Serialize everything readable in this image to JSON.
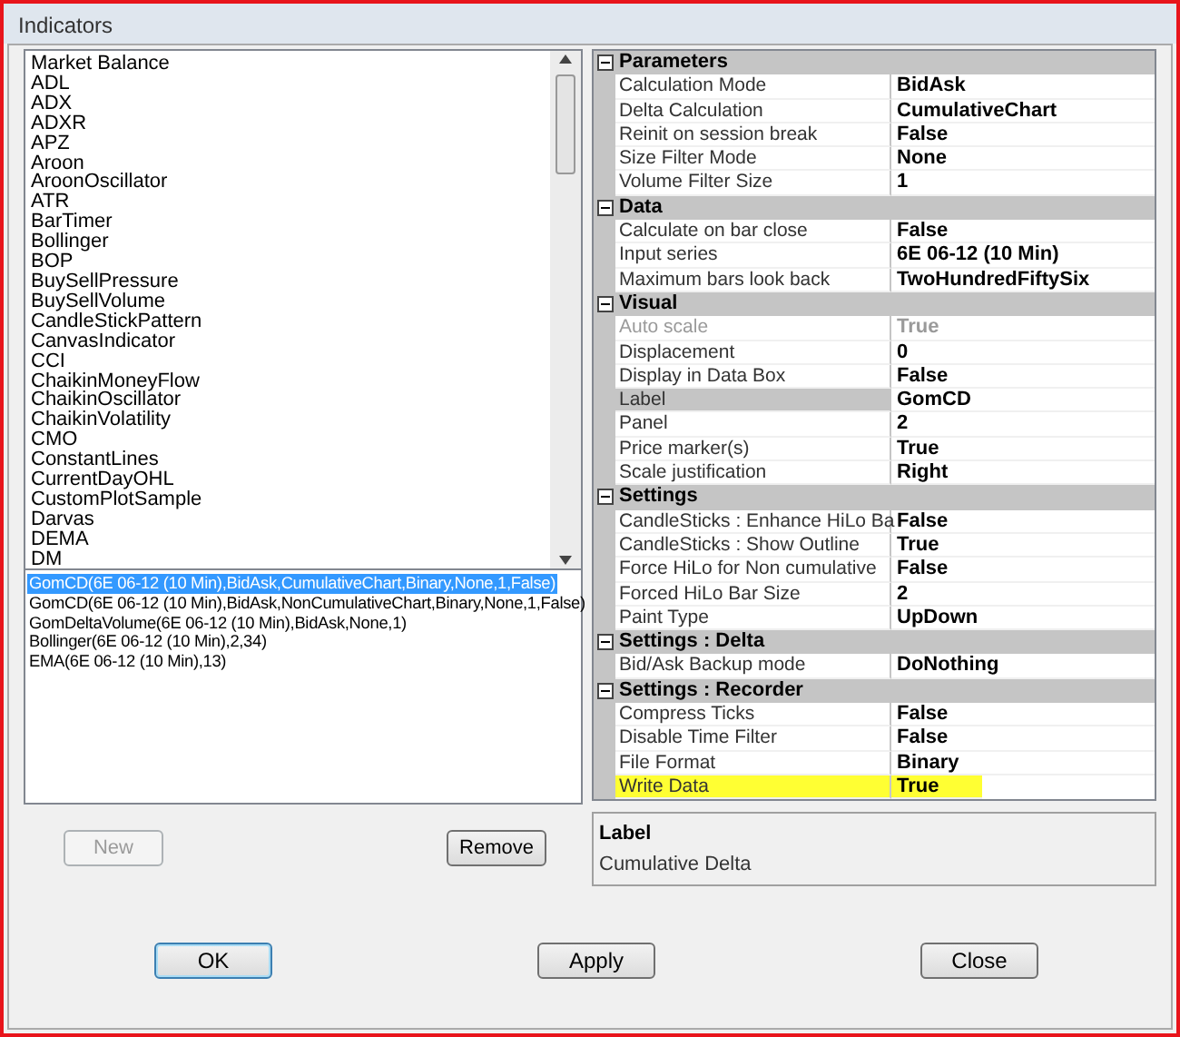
{
  "window": {
    "title": "Indicators"
  },
  "indicator_list": {
    "items": [
      "Market Balance",
      "ADL",
      "ADX",
      "ADXR",
      "APZ",
      "Aroon",
      "AroonOscillator",
      "ATR",
      "BarTimer",
      "Bollinger",
      "BOP",
      "BuySellPressure",
      "BuySellVolume",
      "CandleStickPattern",
      "CanvasIndicator",
      "CCI",
      "ChaikinMoneyFlow",
      "ChaikinOscillator",
      "ChaikinVolatility",
      "CMO",
      "ConstantLines",
      "CurrentDayOHL",
      "CustomPlotSample",
      "Darvas",
      "DEMA",
      "DM"
    ]
  },
  "applied_list": {
    "items": [
      {
        "label": "GomCD(6E 06-12 (10 Min),BidAsk,CumulativeChart,Binary,None,1,False)",
        "selected": true
      },
      {
        "label": "GomCD(6E 06-12 (10 Min),BidAsk,NonCumulativeChart,Binary,None,1,False)",
        "selected": false
      },
      {
        "label": "GomDeltaVolume(6E 06-12 (10 Min),BidAsk,None,1)",
        "selected": false
      },
      {
        "label": "Bollinger(6E 06-12 (10 Min),2,34)",
        "selected": false
      },
      {
        "label": "EMA(6E 06-12 (10 Min),13)",
        "selected": false
      }
    ]
  },
  "list_buttons": [
    {
      "label": "New",
      "disabled": true
    },
    {
      "label": "Remove",
      "disabled": false
    }
  ],
  "properties": {
    "categories": [
      {
        "name": "Parameters",
        "expanded": true,
        "rows": [
          {
            "label": "Calculation Mode",
            "value": "BidAsk",
            "disabled": false,
            "selected": false,
            "highlighted": false
          },
          {
            "label": "Delta Calculation",
            "value": "CumulativeChart",
            "disabled": false,
            "selected": false,
            "highlighted": false
          },
          {
            "label": "Reinit on session break",
            "value": "False",
            "disabled": false,
            "selected": false,
            "highlighted": false
          },
          {
            "label": "Size Filter Mode",
            "value": "None",
            "disabled": false,
            "selected": false,
            "highlighted": false
          },
          {
            "label": "Volume Filter Size",
            "value": "1",
            "disabled": false,
            "selected": false,
            "highlighted": false
          }
        ]
      },
      {
        "name": "Data",
        "expanded": true,
        "rows": [
          {
            "label": "Calculate on bar close",
            "value": "False",
            "disabled": false,
            "selected": false,
            "highlighted": false
          },
          {
            "label": "Input series",
            "value": "6E 06-12 (10 Min)",
            "disabled": false,
            "selected": false,
            "highlighted": false
          },
          {
            "label": "Maximum bars look back",
            "value": "TwoHundredFiftySix",
            "disabled": false,
            "selected": false,
            "highlighted": false
          }
        ]
      },
      {
        "name": "Visual",
        "expanded": true,
        "rows": [
          {
            "label": "Auto scale",
            "value": "True",
            "disabled": true,
            "selected": false,
            "highlighted": false
          },
          {
            "label": "Displacement",
            "value": "0",
            "disabled": false,
            "selected": false,
            "highlighted": false
          },
          {
            "label": "Display in Data Box",
            "value": "False",
            "disabled": false,
            "selected": false,
            "highlighted": false
          },
          {
            "label": "Label",
            "value": "GomCD",
            "disabled": false,
            "selected": true,
            "highlighted": false
          },
          {
            "label": "Panel",
            "value": "2",
            "disabled": false,
            "selected": false,
            "highlighted": false
          },
          {
            "label": "Price marker(s)",
            "value": "True",
            "disabled": false,
            "selected": false,
            "highlighted": false
          },
          {
            "label": "Scale justification",
            "value": "Right",
            "disabled": false,
            "selected": false,
            "highlighted": false
          }
        ]
      },
      {
        "name": "Settings",
        "expanded": true,
        "rows": [
          {
            "label": "CandleSticks : Enhance HiLo Ba",
            "value": "False",
            "disabled": false,
            "selected": false,
            "highlighted": false
          },
          {
            "label": "CandleSticks : Show Outline",
            "value": "True",
            "disabled": false,
            "selected": false,
            "highlighted": false
          },
          {
            "label": "Force HiLo for Non cumulative",
            "value": "False",
            "disabled": false,
            "selected": false,
            "highlighted": false
          },
          {
            "label": "Forced HiLo Bar Size",
            "value": "2",
            "disabled": false,
            "selected": false,
            "highlighted": false
          },
          {
            "label": "Paint Type",
            "value": "UpDown",
            "disabled": false,
            "selected": false,
            "highlighted": false
          }
        ]
      },
      {
        "name": "Settings : Delta",
        "expanded": true,
        "rows": [
          {
            "label": "Bid/Ask Backup mode",
            "value": "DoNothing",
            "disabled": false,
            "selected": false,
            "highlighted": false
          }
        ]
      },
      {
        "name": "Settings : Recorder",
        "expanded": true,
        "rows": [
          {
            "label": "Compress Ticks",
            "value": "False",
            "disabled": false,
            "selected": false,
            "highlighted": false
          },
          {
            "label": "Disable Time Filter",
            "value": "False",
            "disabled": false,
            "selected": false,
            "highlighted": false
          },
          {
            "label": "File Format",
            "value": "Binary",
            "disabled": false,
            "selected": false,
            "highlighted": false
          },
          {
            "label": "Write Data",
            "value": "True",
            "disabled": false,
            "selected": false,
            "highlighted": true
          }
        ]
      }
    ]
  },
  "description": {
    "title": "Label",
    "text": "Cumulative Delta"
  },
  "dialog_buttons": [
    {
      "label": "OK",
      "default": true
    },
    {
      "label": "Apply",
      "default": false
    },
    {
      "label": "Close",
      "default": false
    }
  ]
}
